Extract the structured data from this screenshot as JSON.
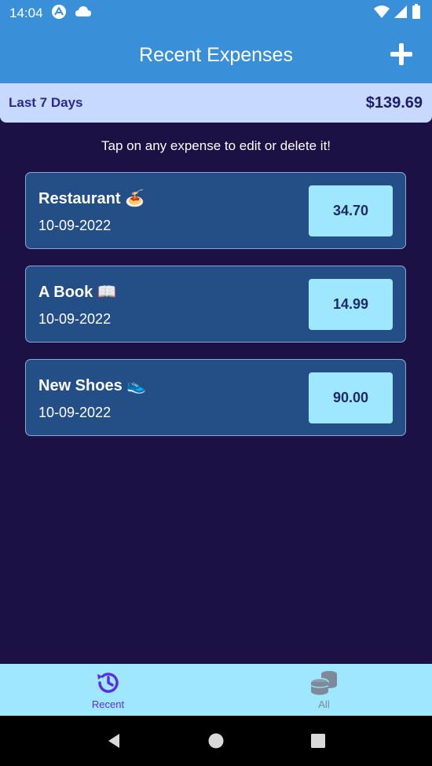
{
  "status_bar": {
    "time": "14:04",
    "icons": [
      "expo-icon",
      "cloud-icon",
      "wifi-icon",
      "signal-icon",
      "battery-icon"
    ]
  },
  "header": {
    "title": "Recent Expenses",
    "add_icon": "plus-icon"
  },
  "summary": {
    "period": "Last 7 Days",
    "sum": "$139.69"
  },
  "hint": "Tap on any expense to edit or delete it!",
  "expenses": [
    {
      "description": "Restaurant 🍝",
      "date": "10-09-2022",
      "amount": "34.70"
    },
    {
      "description": "A Book 📖",
      "date": "10-09-2022",
      "amount": "14.99"
    },
    {
      "description": "New Shoes 👟",
      "date": "10-09-2022",
      "amount": "90.00"
    }
  ],
  "tabs": [
    {
      "label": "Recent",
      "icon": "history-icon",
      "active": true
    },
    {
      "label": "All",
      "icon": "coins-icon",
      "active": false
    }
  ],
  "nav": [
    "back-icon",
    "home-icon",
    "recents-icon"
  ],
  "colors": {
    "accent": "#3a8fd9",
    "background": "#1b1144",
    "card": "#244f86",
    "amount_box": "#9fe6ff",
    "active_tab": "#5b2ee6"
  }
}
